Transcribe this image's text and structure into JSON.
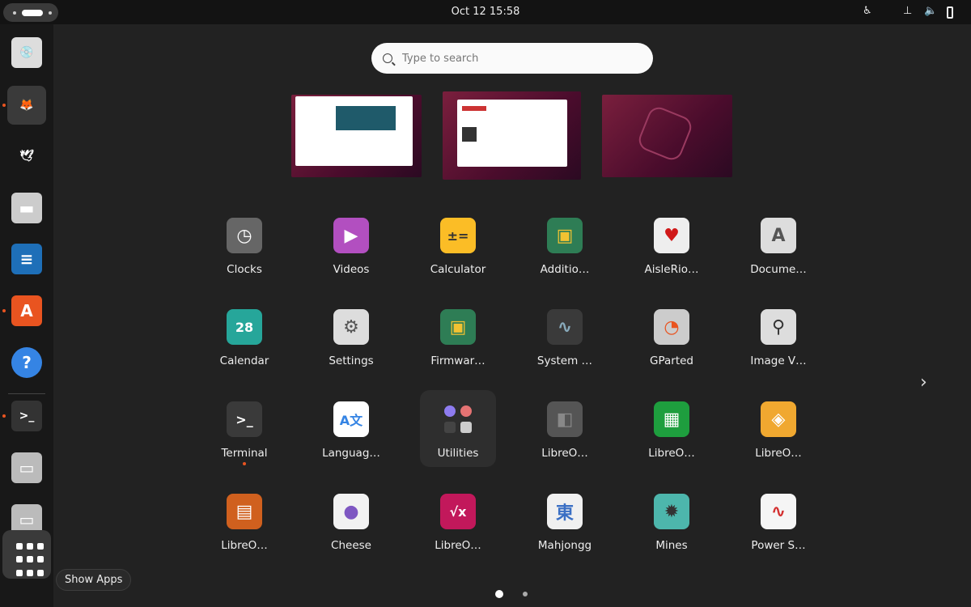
{
  "topbar": {
    "clock": "Oct 12  15:58",
    "tray": [
      "accessibility-icon",
      "network-icon",
      "volume-icon",
      "battery-icon"
    ]
  },
  "search": {
    "placeholder": "Type to search"
  },
  "dock": {
    "items": [
      {
        "name": "disk-usage",
        "running": false
      },
      {
        "name": "firefox",
        "running": true
      },
      {
        "name": "thunderbird",
        "running": false
      },
      {
        "name": "files",
        "running": false
      },
      {
        "name": "libreoffice-writer",
        "running": false
      },
      {
        "name": "app-center",
        "running": true
      },
      {
        "name": "help",
        "running": false
      },
      {
        "name": "terminal",
        "running": true
      },
      {
        "name": "drive",
        "running": false
      },
      {
        "name": "drive",
        "running": false
      }
    ],
    "show_apps_tooltip": "Show Apps"
  },
  "apps": [
    {
      "label": "Clocks",
      "glyph": "◷",
      "bg": "#666666",
      "fg": "#fff"
    },
    {
      "label": "Videos",
      "glyph": "▶",
      "bg": "#b24fc0",
      "fg": "#fff"
    },
    {
      "label": "Calculator",
      "glyph": "±=",
      "bg": "#fbbd26",
      "fg": "#333"
    },
    {
      "label": "Additio…",
      "glyph": "▣",
      "bg": "#2e7d55",
      "fg": "#f1c232"
    },
    {
      "label": "AisleRio…",
      "glyph": "♥",
      "bg": "#eeeeee",
      "fg": "#d01818"
    },
    {
      "label": "Docume…",
      "glyph": "A",
      "bg": "#dddddd",
      "fg": "#555"
    },
    {
      "label": "Calendar",
      "glyph": "28",
      "bg": "#26a69a",
      "fg": "#fff"
    },
    {
      "label": "Settings",
      "glyph": "⚙",
      "bg": "#dddddd",
      "fg": "#555"
    },
    {
      "label": "Firmwar…",
      "glyph": "▣",
      "bg": "#2e7d55",
      "fg": "#f1c232"
    },
    {
      "label": "System …",
      "glyph": "∿",
      "bg": "#3a3a3a",
      "fg": "#8ab"
    },
    {
      "label": "GParted",
      "glyph": "◔",
      "bg": "#cccccc",
      "fg": "#e95420"
    },
    {
      "label": "Image V…",
      "glyph": "⚲",
      "bg": "#dddddd",
      "fg": "#333"
    },
    {
      "label": "Terminal",
      "glyph": ">_",
      "bg": "#3a3a3a",
      "fg": "#fff",
      "running": true
    },
    {
      "label": "Languag…",
      "glyph": "A文",
      "bg": "#ffffff",
      "fg": "#3584e4"
    },
    {
      "label": "Utilities",
      "glyph": "",
      "bg": "transparent",
      "fg": "#fff",
      "folder": true
    },
    {
      "label": "LibreO…",
      "glyph": "◧",
      "bg": "#555555",
      "fg": "#888"
    },
    {
      "label": "LibreO…",
      "glyph": "▦",
      "bg": "#1e9e3e",
      "fg": "#fff"
    },
    {
      "label": "LibreO…",
      "glyph": "◈",
      "bg": "#f0a830",
      "fg": "#fff"
    },
    {
      "label": "LibreO…",
      "glyph": "▤",
      "bg": "#d0601e",
      "fg": "#fff"
    },
    {
      "label": "Cheese",
      "glyph": "●",
      "bg": "#f2f2f2",
      "fg": "#7e57c2"
    },
    {
      "label": "LibreO…",
      "glyph": "√x",
      "bg": "#c2185b",
      "fg": "#fff"
    },
    {
      "label": "Mahjongg",
      "glyph": "東",
      "bg": "#f0f0f0",
      "fg": "#3a6fc4"
    },
    {
      "label": "Mines",
      "glyph": "✹",
      "bg": "#4db6ac",
      "fg": "#333"
    },
    {
      "label": "Power S…",
      "glyph": "∿",
      "bg": "#f5f5f5",
      "fg": "#d32f2f"
    }
  ],
  "pages": {
    "current": 1,
    "total": 2
  },
  "colors": {
    "accent": "#e95420",
    "background": "#222222"
  }
}
